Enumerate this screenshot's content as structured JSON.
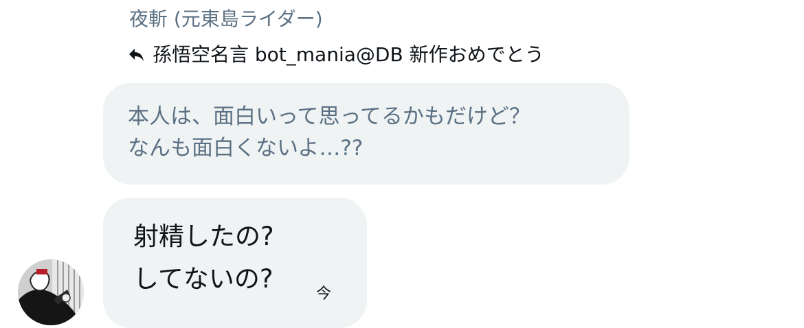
{
  "conversation": {
    "sender_name": "夜斬 (元東島ライダー)",
    "reply_icon": "reply-arrow-icon",
    "reply_target": "孫悟空名言 bot_mania@DB 新作おめでとう",
    "quoted_message": {
      "lines": [
        "本人は、面白いって思ってるかもだけど？",
        "なんも面白くないよ…??"
      ]
    },
    "message": {
      "lines": [
        "射精したの?",
        "してないの?"
      ],
      "timestamp": "今"
    },
    "avatar": "user-avatar-image"
  },
  "colors": {
    "bubble_background": "#eff3f4",
    "muted_text": "#5b7083",
    "primary_text": "#0f1419"
  }
}
